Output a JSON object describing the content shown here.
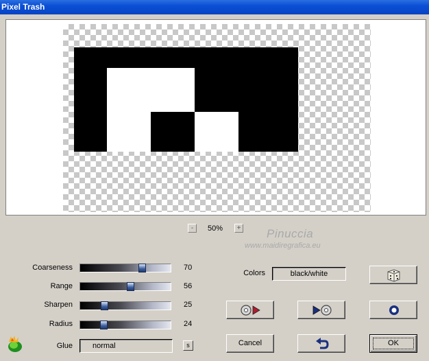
{
  "window": {
    "title": "Pixel Trash"
  },
  "zoom": {
    "minus_label": "-",
    "plus_label": "+",
    "value": "50%"
  },
  "watermark": {
    "name": "Pinuccia",
    "url": "www.maidiregrafica.eu"
  },
  "controls": {
    "sliders": [
      {
        "label": "Coarseness",
        "value": "70",
        "fraction": 0.7
      },
      {
        "label": "Range",
        "value": "56",
        "fraction": 0.56
      },
      {
        "label": "Sharpen",
        "value": "25",
        "fraction": 0.25
      },
      {
        "label": "Radius",
        "value": "24",
        "fraction": 0.24
      }
    ],
    "glue": {
      "label": "Glue",
      "value": "normal",
      "s_button": "s"
    },
    "colors": {
      "label": "Colors",
      "value": "black/white"
    }
  },
  "buttons": {
    "cancel": "Cancel",
    "ok": "OK",
    "random_icon": "dice-icon",
    "reset_icon": "target-icon",
    "undo_icon": "undo-icon",
    "prev_icon": "disc-play-left-icon",
    "next_icon": "play-disc-right-icon"
  },
  "colors": {
    "titlebar": "#0a4fd6",
    "face": "#d4d0c8",
    "black": "#000000",
    "white": "#ffffff"
  }
}
